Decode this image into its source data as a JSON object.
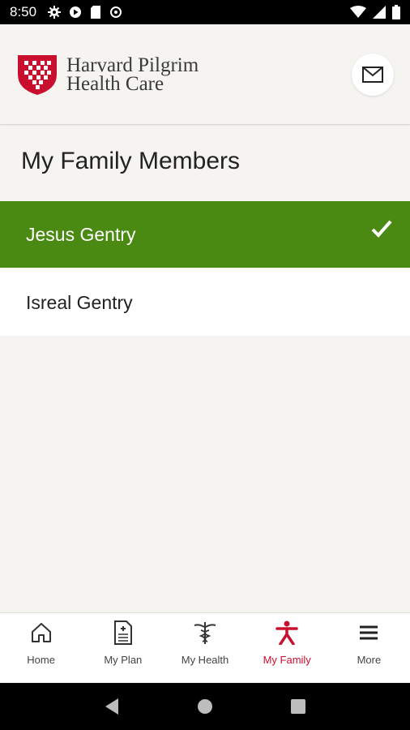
{
  "status_bar": {
    "time": "8:50"
  },
  "header": {
    "logo_line1": "Harvard Pilgrim",
    "logo_line2": "Health Care",
    "brand_color": "#c8102e"
  },
  "page": {
    "title": "My Family Members"
  },
  "members": [
    {
      "name": "Jesus Gentry",
      "selected": true
    },
    {
      "name": "Isreal Gentry",
      "selected": false
    }
  ],
  "bottom_nav": {
    "items": [
      {
        "label": "Home",
        "icon": "home-icon"
      },
      {
        "label": "My Plan",
        "icon": "document-icon"
      },
      {
        "label": "My Health",
        "icon": "caduceus-icon"
      },
      {
        "label": "My Family",
        "icon": "person-icon",
        "active": true
      },
      {
        "label": "More",
        "icon": "menu-icon"
      }
    ]
  },
  "colors": {
    "selected_row": "#4a8a12",
    "active_nav": "#c8102e"
  }
}
